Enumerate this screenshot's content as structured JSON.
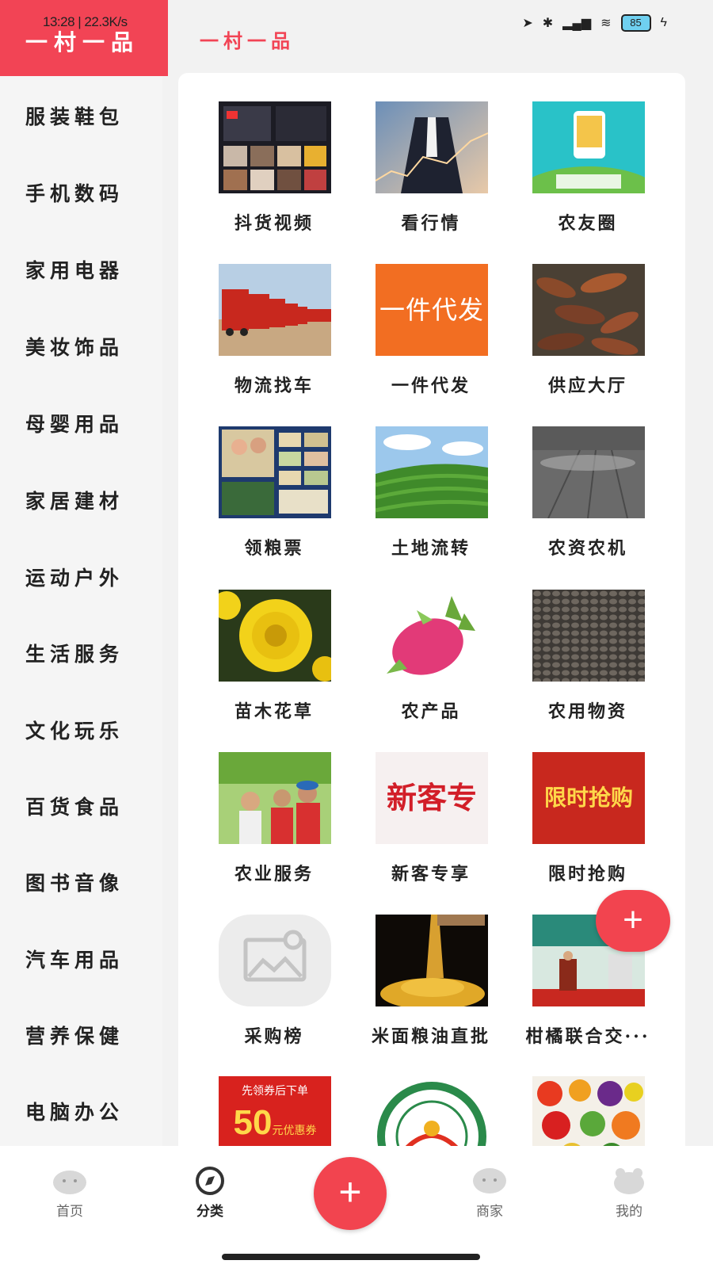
{
  "status": {
    "time": "13:28",
    "speed": "22.3K/s",
    "battery": "85"
  },
  "sidebar": {
    "active_label": "一村一品",
    "items": [
      "服装鞋包",
      "手机数码",
      "家用电器",
      "美妆饰品",
      "母婴用品",
      "家居建材",
      "运动户外",
      "生活服务",
      "文化玩乐",
      "百货食品",
      "图书音像",
      "汽车用品",
      "营养保健",
      "电脑办公"
    ]
  },
  "content": {
    "title": "一村一品",
    "tiles": [
      {
        "label": "抖货视频",
        "icon": "video-thumbnail"
      },
      {
        "label": "看行情",
        "icon": "market-trend-thumbnail"
      },
      {
        "label": "农友圈",
        "icon": "farmer-circle-thumbnail"
      },
      {
        "label": "物流找车",
        "icon": "truck-fleet-thumbnail"
      },
      {
        "label": "一件代发",
        "icon": "dropship-thumbnail",
        "text": "一件代发"
      },
      {
        "label": "供应大厅",
        "icon": "crayfish-thumbnail"
      },
      {
        "label": "领粮票",
        "icon": "grain-ticket-thumbnail"
      },
      {
        "label": "土地流转",
        "icon": "tea-field-thumbnail"
      },
      {
        "label": "农资农机",
        "icon": "irrigation-thumbnail"
      },
      {
        "label": "苗木花草",
        "icon": "chrysanthemum-thumbnail"
      },
      {
        "label": "农产品",
        "icon": "dragon-fruit-thumbnail"
      },
      {
        "label": "农用物资",
        "icon": "seeds-thumbnail"
      },
      {
        "label": "农业服务",
        "icon": "farmers-thumbnail"
      },
      {
        "label": "新客专享",
        "icon": "new-customer-thumbnail",
        "text": "新客专享"
      },
      {
        "label": "限时抢购",
        "icon": "flash-sale-thumbnail",
        "text": "限时抢购"
      },
      {
        "label": "采购榜",
        "icon": "image-placeholder-icon"
      },
      {
        "label": "米面粮油直批",
        "icon": "grain-pour-thumbnail"
      },
      {
        "label": "柑橘联合交···",
        "icon": "ceremony-thumbnail"
      },
      {
        "label": "",
        "icon": "coupon-thumbnail",
        "text": "先领券后下单",
        "amount": "50",
        "unit": "元优惠券"
      },
      {
        "label": "",
        "icon": "geo-indication-badge-thumbnail"
      },
      {
        "label": "",
        "icon": "vegetables-thumbnail"
      }
    ]
  },
  "fab": {
    "label": "+"
  },
  "bottom_nav": [
    {
      "label": "首页",
      "icon": "home-icon"
    },
    {
      "label": "分类",
      "icon": "compass-icon"
    },
    {
      "label": "+",
      "icon": "plus-icon"
    },
    {
      "label": "商家",
      "icon": "merchant-icon"
    },
    {
      "label": "我的",
      "icon": "profile-icon"
    }
  ],
  "colors": {
    "accent": "#f24455",
    "panel": "#ffffff",
    "background": "#f2f2f2"
  }
}
